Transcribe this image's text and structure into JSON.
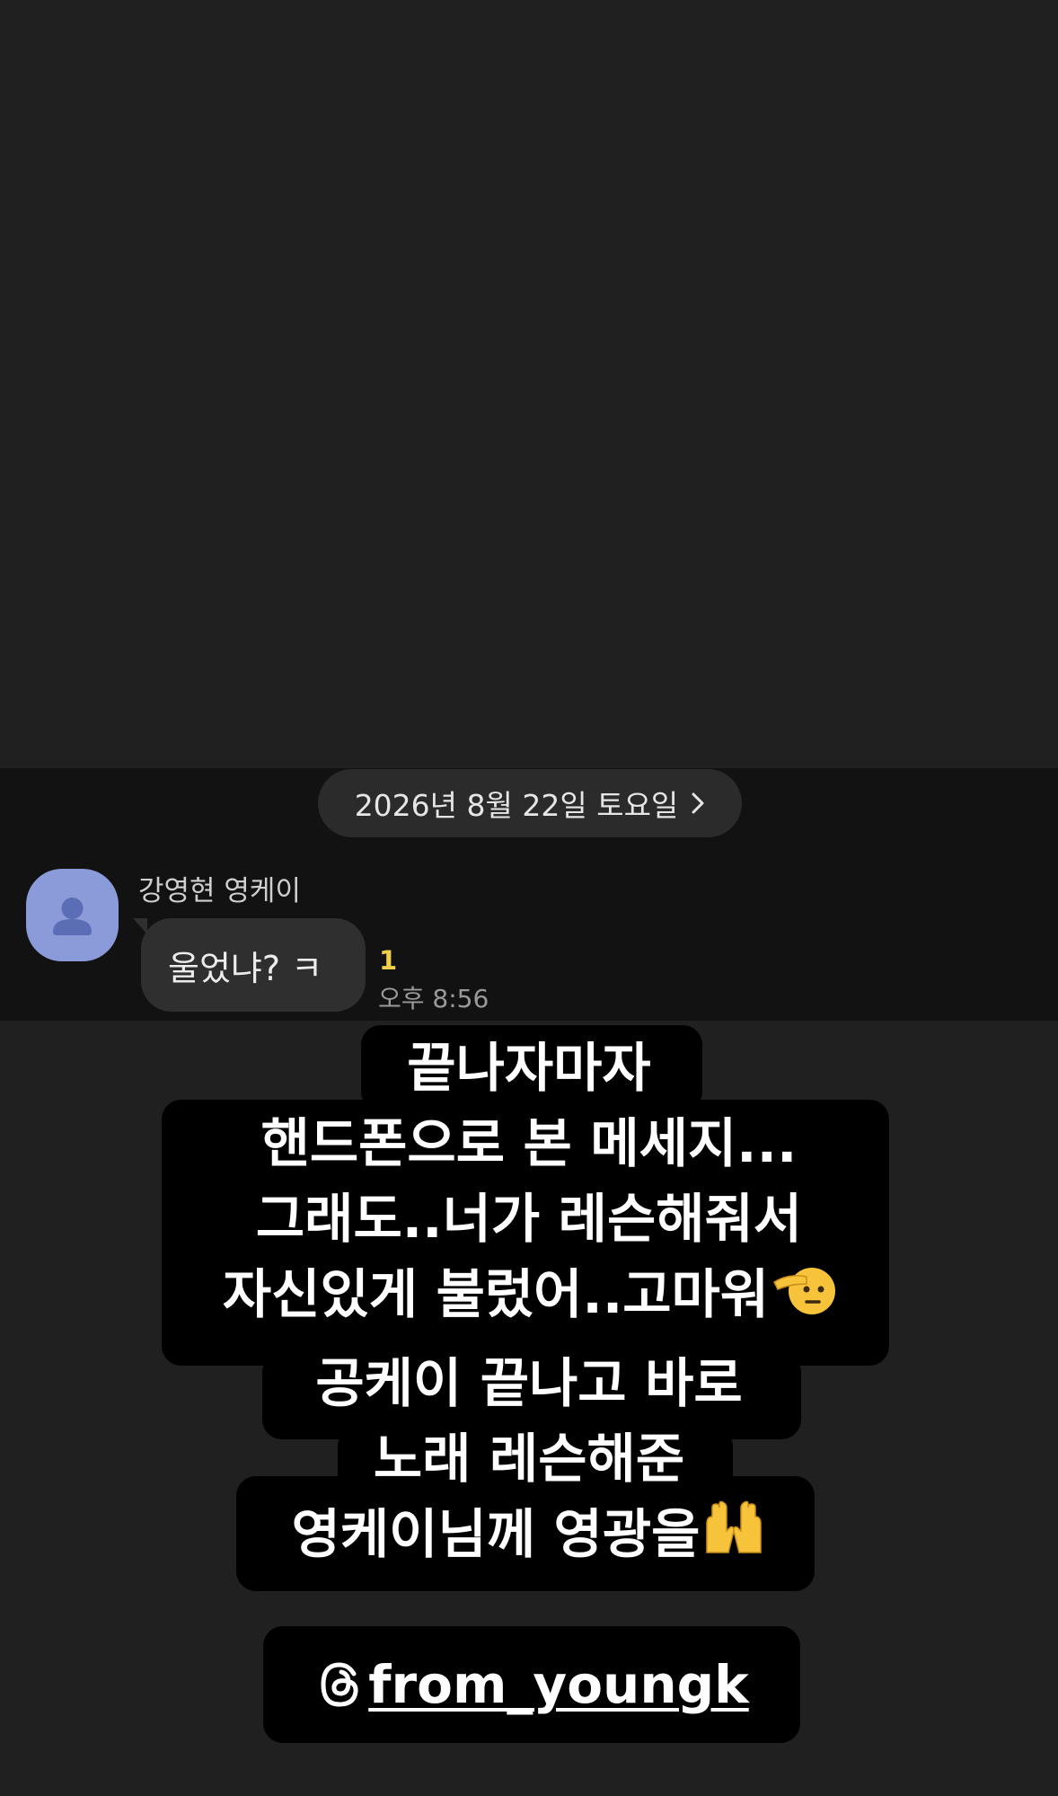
{
  "chat": {
    "date_label": "2026년 8월 22일 토요일",
    "sender_name": "강영현 영케이",
    "message": "울었냐? ㅋ",
    "unread_count": "1",
    "time": "오후 8:56"
  },
  "caption": {
    "lines": [
      "끝나자마자",
      "핸드폰으로 본 메세지...",
      "그래도..너가 레슨해줘서",
      "자신있게 불렀어..고마워",
      "공케이 끝나고 바로",
      "노래 레슨해준",
      "영케이님께 영광을"
    ],
    "emojis": [
      "saluting-face",
      "raising-hands"
    ]
  },
  "mention": {
    "handle": "from_youngk",
    "icon": "threads-icon"
  },
  "colors": {
    "background": "#202020",
    "chat_strip": "#121212",
    "bubble": "#2f2f2f",
    "unread": "#f0d04a",
    "avatar": "#8b9bd9"
  }
}
